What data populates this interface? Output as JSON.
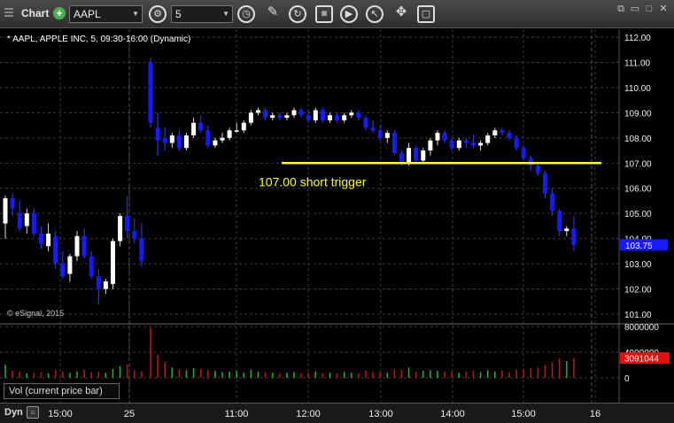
{
  "toolbar": {
    "chart_label": "Chart",
    "symbol": "AAPL",
    "interval": "5"
  },
  "chart": {
    "title": "* AAPL, APPLE INC, 5, 09:30-16:00 (Dynamic)",
    "copyright": "© eSignal, 2015",
    "annotation": "107.00 short trigger",
    "current_price": "103.75",
    "current_volume": "3091044",
    "volume_label": "Vol (current price bar)",
    "dyn_label": "Dyn",
    "colors": {
      "up": "#ffffff",
      "down": "#1a1aff",
      "trigger": "#ffff33",
      "price_badge": "#1a1aff",
      "vol_badge": "#e01010"
    }
  },
  "chart_data": {
    "type": "candlestick",
    "price_axis": {
      "ticks": [
        "112.00",
        "111.00",
        "110.00",
        "109.00",
        "108.00",
        "107.00",
        "106.00",
        "105.00",
        "104.00",
        "103.00",
        "102.00",
        "101.00"
      ],
      "ylim": [
        100.8,
        112.2
      ]
    },
    "volume_axis": {
      "ticks": [
        "8000000",
        "4000000",
        "0"
      ],
      "ylim": [
        0,
        8500000
      ]
    },
    "time_ticks": [
      "15:00",
      "25",
      "11:00",
      "12:00",
      "13:00",
      "14:00",
      "15:00",
      "16"
    ],
    "horizontal_line": {
      "price": 107.0,
      "label": "107.00 short trigger"
    },
    "candles": [
      {
        "o": 104.6,
        "h": 105.7,
        "l": 104.0,
        "c": 105.6
      },
      {
        "o": 105.6,
        "h": 105.8,
        "l": 104.9,
        "c": 105.2
      },
      {
        "o": 105.0,
        "h": 105.5,
        "l": 104.3,
        "c": 104.4
      },
      {
        "o": 104.5,
        "h": 105.2,
        "l": 104.2,
        "c": 105.0
      },
      {
        "o": 105.0,
        "h": 105.2,
        "l": 104.1,
        "c": 104.2
      },
      {
        "o": 104.2,
        "h": 104.5,
        "l": 103.6,
        "c": 103.8
      },
      {
        "o": 103.7,
        "h": 104.6,
        "l": 103.5,
        "c": 104.2
      },
      {
        "o": 104.1,
        "h": 104.3,
        "l": 102.8,
        "c": 103.0
      },
      {
        "o": 103.0,
        "h": 103.5,
        "l": 102.4,
        "c": 102.5
      },
      {
        "o": 102.6,
        "h": 103.4,
        "l": 102.3,
        "c": 103.3
      },
      {
        "o": 103.3,
        "h": 104.3,
        "l": 103.1,
        "c": 104.1
      },
      {
        "o": 104.1,
        "h": 104.4,
        "l": 103.2,
        "c": 103.3
      },
      {
        "o": 103.3,
        "h": 103.5,
        "l": 102.4,
        "c": 102.5
      },
      {
        "o": 102.5,
        "h": 102.8,
        "l": 101.4,
        "c": 102.0
      },
      {
        "o": 102.0,
        "h": 102.4,
        "l": 101.8,
        "c": 102.3
      },
      {
        "o": 102.2,
        "h": 104.0,
        "l": 102.0,
        "c": 103.9
      },
      {
        "o": 103.9,
        "h": 105.0,
        "l": 103.7,
        "c": 104.9
      },
      {
        "o": 104.9,
        "h": 105.7,
        "l": 104.0,
        "c": 104.3
      },
      {
        "o": 104.3,
        "h": 104.8,
        "l": 103.8,
        "c": 104.0
      },
      {
        "o": 104.0,
        "h": 104.6,
        "l": 102.9,
        "c": 103.1
      },
      {
        "o": 111.0,
        "h": 111.2,
        "l": 108.4,
        "c": 108.6
      },
      {
        "o": 108.4,
        "h": 109.0,
        "l": 107.3,
        "c": 107.9
      },
      {
        "o": 108.0,
        "h": 108.4,
        "l": 107.5,
        "c": 107.8
      },
      {
        "o": 107.8,
        "h": 108.2,
        "l": 107.6,
        "c": 108.1
      },
      {
        "o": 108.1,
        "h": 108.3,
        "l": 107.5,
        "c": 107.6
      },
      {
        "o": 107.6,
        "h": 108.2,
        "l": 107.5,
        "c": 108.1
      },
      {
        "o": 108.1,
        "h": 108.8,
        "l": 108.0,
        "c": 108.6
      },
      {
        "o": 108.6,
        "h": 108.9,
        "l": 108.2,
        "c": 108.3
      },
      {
        "o": 108.3,
        "h": 108.5,
        "l": 107.6,
        "c": 107.7
      },
      {
        "o": 107.7,
        "h": 108.0,
        "l": 107.6,
        "c": 107.9
      },
      {
        "o": 107.9,
        "h": 108.2,
        "l": 107.8,
        "c": 108.0
      },
      {
        "o": 108.0,
        "h": 108.4,
        "l": 107.9,
        "c": 108.3
      },
      {
        "o": 108.3,
        "h": 108.6,
        "l": 108.2,
        "c": 108.3
      },
      {
        "o": 108.3,
        "h": 108.7,
        "l": 108.2,
        "c": 108.6
      },
      {
        "o": 108.6,
        "h": 109.1,
        "l": 108.5,
        "c": 109.0
      },
      {
        "o": 109.0,
        "h": 109.2,
        "l": 108.9,
        "c": 109.1
      },
      {
        "o": 109.1,
        "h": 109.2,
        "l": 108.7,
        "c": 108.8
      },
      {
        "o": 108.8,
        "h": 109.0,
        "l": 108.7,
        "c": 108.9
      },
      {
        "o": 108.9,
        "h": 109.0,
        "l": 108.7,
        "c": 108.8
      },
      {
        "o": 108.8,
        "h": 109.0,
        "l": 108.7,
        "c": 108.9
      },
      {
        "o": 108.9,
        "h": 109.2,
        "l": 108.8,
        "c": 109.1
      },
      {
        "o": 109.1,
        "h": 109.2,
        "l": 108.8,
        "c": 108.9
      },
      {
        "o": 108.9,
        "h": 109.1,
        "l": 108.6,
        "c": 108.7
      },
      {
        "o": 108.7,
        "h": 109.2,
        "l": 108.6,
        "c": 109.1
      },
      {
        "o": 109.1,
        "h": 109.2,
        "l": 108.6,
        "c": 108.7
      },
      {
        "o": 108.7,
        "h": 109.0,
        "l": 108.6,
        "c": 108.9
      },
      {
        "o": 108.9,
        "h": 109.0,
        "l": 108.6,
        "c": 108.7
      },
      {
        "o": 108.7,
        "h": 109.0,
        "l": 108.6,
        "c": 108.9
      },
      {
        "o": 108.9,
        "h": 109.1,
        "l": 108.8,
        "c": 109.0
      },
      {
        "o": 109.0,
        "h": 109.1,
        "l": 108.7,
        "c": 108.8
      },
      {
        "o": 108.8,
        "h": 108.9,
        "l": 108.3,
        "c": 108.4
      },
      {
        "o": 108.4,
        "h": 108.7,
        "l": 108.2,
        "c": 108.3
      },
      {
        "o": 108.3,
        "h": 108.5,
        "l": 107.9,
        "c": 108.0
      },
      {
        "o": 108.0,
        "h": 108.3,
        "l": 107.8,
        "c": 108.2
      },
      {
        "o": 108.2,
        "h": 108.3,
        "l": 107.3,
        "c": 107.4
      },
      {
        "o": 107.4,
        "h": 107.5,
        "l": 106.9,
        "c": 107.0
      },
      {
        "o": 107.0,
        "h": 107.8,
        "l": 106.9,
        "c": 107.6
      },
      {
        "o": 107.6,
        "h": 107.7,
        "l": 107.0,
        "c": 107.1
      },
      {
        "o": 107.1,
        "h": 107.6,
        "l": 107.0,
        "c": 107.5
      },
      {
        "o": 107.5,
        "h": 108.0,
        "l": 107.3,
        "c": 107.9
      },
      {
        "o": 107.9,
        "h": 108.3,
        "l": 107.7,
        "c": 108.2
      },
      {
        "o": 108.2,
        "h": 108.3,
        "l": 107.8,
        "c": 107.9
      },
      {
        "o": 107.9,
        "h": 108.0,
        "l": 107.5,
        "c": 107.6
      },
      {
        "o": 107.6,
        "h": 108.0,
        "l": 107.5,
        "c": 107.9
      },
      {
        "o": 107.9,
        "h": 108.0,
        "l": 107.6,
        "c": 107.8
      },
      {
        "o": 107.8,
        "h": 108.1,
        "l": 107.6,
        "c": 107.7
      },
      {
        "o": 107.7,
        "h": 107.9,
        "l": 107.5,
        "c": 107.8
      },
      {
        "o": 107.8,
        "h": 108.2,
        "l": 107.7,
        "c": 108.1
      },
      {
        "o": 108.1,
        "h": 108.4,
        "l": 108.0,
        "c": 108.3
      },
      {
        "o": 108.3,
        "h": 108.4,
        "l": 108.1,
        "c": 108.2
      },
      {
        "o": 108.2,
        "h": 108.3,
        "l": 107.9,
        "c": 108.0
      },
      {
        "o": 108.0,
        "h": 108.1,
        "l": 107.5,
        "c": 107.6
      },
      {
        "o": 107.6,
        "h": 107.7,
        "l": 107.1,
        "c": 107.2
      },
      {
        "o": 107.2,
        "h": 107.3,
        "l": 106.7,
        "c": 106.9
      },
      {
        "o": 106.9,
        "h": 107.0,
        "l": 106.5,
        "c": 106.6
      },
      {
        "o": 106.6,
        "h": 106.7,
        "l": 105.6,
        "c": 105.8
      },
      {
        "o": 105.8,
        "h": 106.0,
        "l": 104.9,
        "c": 105.1
      },
      {
        "o": 105.1,
        "h": 105.2,
        "l": 104.1,
        "c": 104.3
      },
      {
        "o": 104.3,
        "h": 104.5,
        "l": 104.1,
        "c": 104.4
      },
      {
        "o": 104.4,
        "h": 104.9,
        "l": 103.5,
        "c": 103.75
      }
    ],
    "volumes": [
      2100000,
      1100000,
      900000,
      700000,
      800000,
      900000,
      700000,
      1200000,
      1000000,
      800000,
      1000000,
      1300000,
      900000,
      1000000,
      800000,
      1400000,
      1800000,
      2100000,
      1200000,
      1000000,
      7800000,
      3600000,
      2400000,
      1600000,
      1300000,
      1200000,
      1500000,
      1400000,
      1200000,
      1100000,
      900000,
      1000000,
      1100000,
      800000,
      1300000,
      1000000,
      900000,
      800000,
      700000,
      800000,
      900000,
      700000,
      800000,
      1000000,
      700000,
      800000,
      700000,
      900000,
      800000,
      700000,
      1100000,
      900000,
      1000000,
      800000,
      1400000,
      1300000,
      1600000,
      1000000,
      1100000,
      1200000,
      1100000,
      1000000,
      900000,
      800000,
      1000000,
      1100000,
      900000,
      1200000,
      1000000,
      1100000,
      900000,
      1300000,
      1400000,
      1500000,
      1600000,
      2000000,
      2400000,
      3000000,
      2600000,
      3091044
    ]
  }
}
